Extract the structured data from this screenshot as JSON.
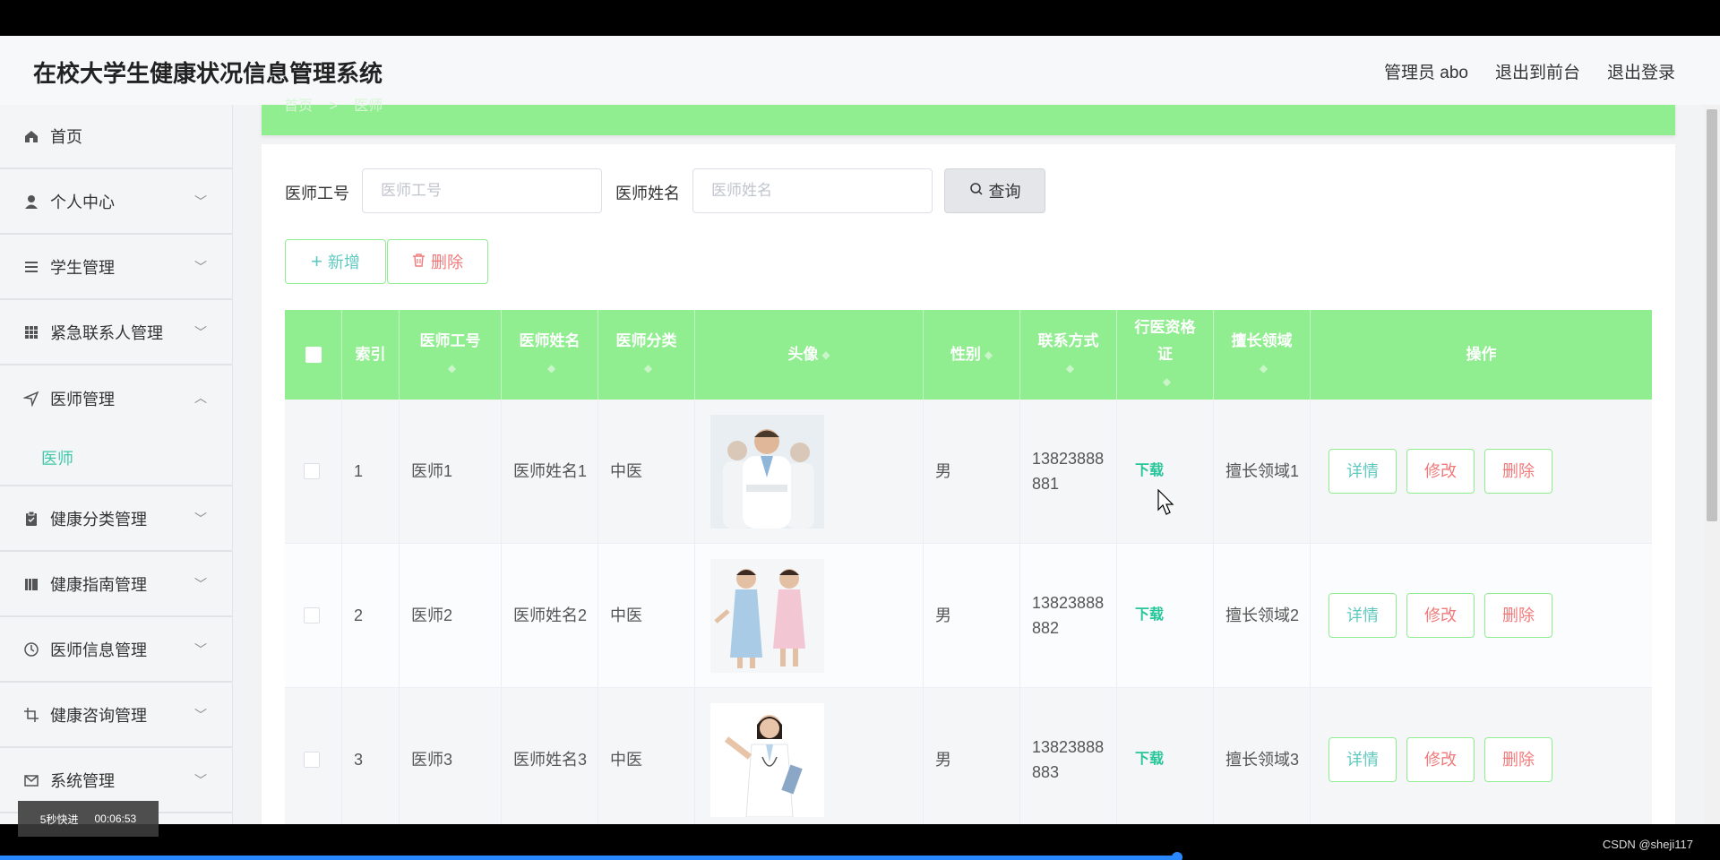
{
  "header": {
    "title": "在校大学生健康状况信息管理系统",
    "user": "管理员 abo",
    "to_front": "退出到前台",
    "logout": "退出登录"
  },
  "sidebar": {
    "items": [
      {
        "label": "首页",
        "icon": "home-icon"
      },
      {
        "label": "个人中心",
        "icon": "user-icon"
      },
      {
        "label": "学生管理",
        "icon": "list-icon"
      },
      {
        "label": "紧急联系人管理",
        "icon": "grid-icon"
      },
      {
        "label": "医师管理",
        "icon": "navigation-icon"
      },
      {
        "label": "健康分类管理",
        "icon": "clipboard-icon"
      },
      {
        "label": "健康指南管理",
        "icon": "book-icon"
      },
      {
        "label": "医师信息管理",
        "icon": "clock-icon"
      },
      {
        "label": "健康咨询管理",
        "icon": "crop-icon"
      },
      {
        "label": "系统管理",
        "icon": "mail-icon"
      }
    ],
    "sub_active": "医师"
  },
  "breadcrumb": {
    "home": "首页",
    "sep": ">",
    "current": "医师"
  },
  "search": {
    "id_label": "医师工号",
    "id_placeholder": "医师工号",
    "name_label": "医师姓名",
    "name_placeholder": "医师姓名",
    "query": "查询"
  },
  "actions": {
    "add": "新增",
    "delete": "删除"
  },
  "table": {
    "headers": {
      "index": "索引",
      "doc_id": "医师工号",
      "doc_name": "医师姓名",
      "category": "医师分类",
      "avatar": "头像",
      "gender": "性别",
      "contact": "联系方式",
      "license": "行医资格证",
      "specialty": "擅长领域",
      "ops": "操作"
    },
    "rows": [
      {
        "index": "1",
        "doc_id": "医师1",
        "doc_name": "医师姓名1",
        "category": "中医",
        "gender": "男",
        "contact": "13823888881",
        "license": "下载",
        "specialty": "擅长领域1"
      },
      {
        "index": "2",
        "doc_id": "医师2",
        "doc_name": "医师姓名2",
        "category": "中医",
        "gender": "男",
        "contact": "13823888882",
        "license": "下载",
        "specialty": "擅长领域2"
      },
      {
        "index": "3",
        "doc_id": "医师3",
        "doc_name": "医师姓名3",
        "category": "中医",
        "gender": "男",
        "contact": "13823888883",
        "license": "下载",
        "specialty": "擅长领域3"
      }
    ],
    "row_buttons": {
      "detail": "详情",
      "edit": "修改",
      "delete": "删除"
    }
  },
  "overlay": {
    "speed": "5秒快进",
    "time": "00:06:53",
    "watermark": "CSDN @sheji117"
  },
  "colors": {
    "accent_green": "#90ee90",
    "teal": "#5fc9c0",
    "danger": "#f07a7a",
    "download": "#26c59a"
  }
}
